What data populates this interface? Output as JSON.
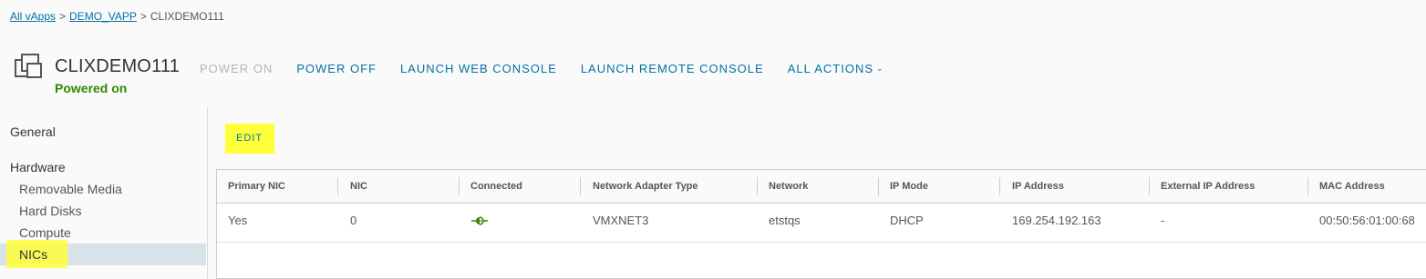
{
  "breadcrumb": {
    "items": [
      "All vApps",
      "DEMO_VAPP",
      "CLIXDEMO111"
    ],
    "separator": ">"
  },
  "vm": {
    "name": "CLIXDEMO111",
    "status": "Powered on",
    "status_color": "#318700",
    "icon": "vm-icon"
  },
  "actions": {
    "power_on": "POWER ON",
    "power_off": "POWER OFF",
    "launch_web_console": "LAUNCH WEB CONSOLE",
    "launch_remote_console": "LAUNCH REMOTE CONSOLE",
    "all_actions": "ALL ACTIONS"
  },
  "sidebar": {
    "general": "General",
    "hardware": "Hardware",
    "items": [
      "Removable Media",
      "Hard Disks",
      "Compute",
      "NICs"
    ],
    "active": "NICs"
  },
  "edit_label": "EDIT",
  "table": {
    "columns": [
      "Primary NIC",
      "NIC",
      "Connected",
      "Network Adapter Type",
      "Network",
      "IP Mode",
      "IP Address",
      "External IP Address",
      "MAC Address"
    ],
    "rows": [
      {
        "primary_nic": "Yes",
        "nic": "0",
        "connected_icon": "connected-icon",
        "adapter_type": "VMXNET3",
        "network": "etstqs",
        "ip_mode": "DHCP",
        "ip_address": "169.254.192.163",
        "external_ip": "-",
        "mac_address": "00:50:56:01:00:68"
      }
    ]
  },
  "colors": {
    "link": "#0072a3",
    "highlight": "#ffff3a",
    "connected": "#318700",
    "disabled": "#b3b3b3"
  }
}
